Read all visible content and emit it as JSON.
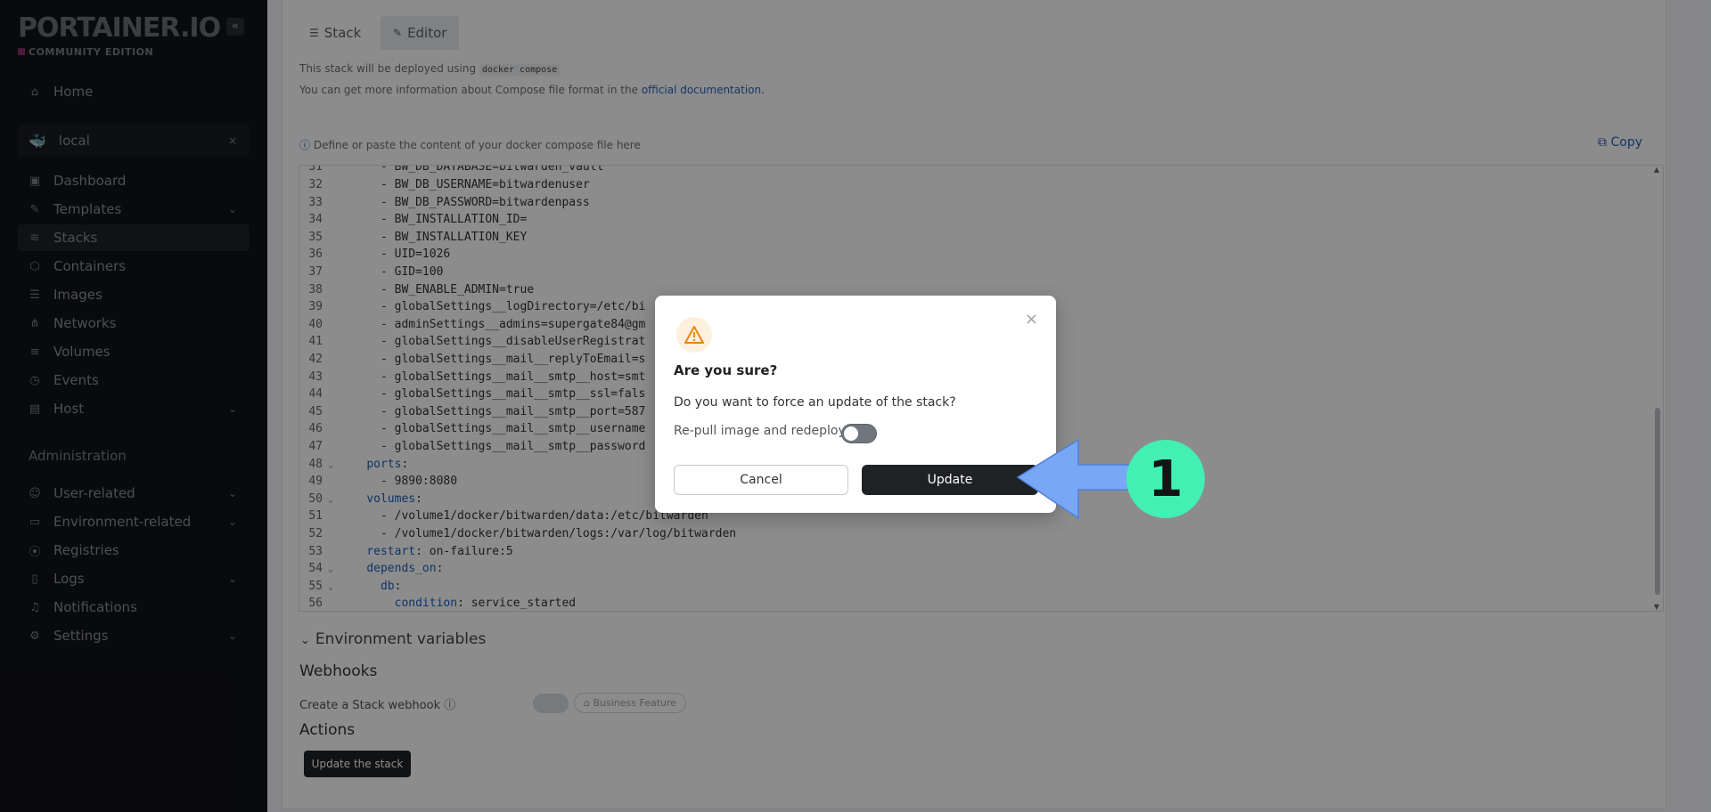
{
  "sidebar": {
    "logo": "PORTAINER.IO",
    "edition": "COMMUNITY EDITION",
    "collapse_icon": "«",
    "home": "Home",
    "environment": {
      "name": "local",
      "close": "×"
    },
    "env_items": [
      {
        "label": "Dashboard",
        "icon": "dashboard-icon"
      },
      {
        "label": "Templates",
        "icon": "templates-icon"
      },
      {
        "label": "Stacks",
        "icon": "stacks-icon"
      },
      {
        "label": "Containers",
        "icon": "containers-icon"
      },
      {
        "label": "Images",
        "icon": "images-icon"
      },
      {
        "label": "Networks",
        "icon": "networks-icon"
      },
      {
        "label": "Volumes",
        "icon": "volumes-icon"
      },
      {
        "label": "Events",
        "icon": "events-icon"
      },
      {
        "label": "Host",
        "icon": "host-icon"
      }
    ],
    "admin_label": "Administration",
    "admin_items": [
      {
        "label": "User-related"
      },
      {
        "label": "Environment-related"
      },
      {
        "label": "Registries"
      },
      {
        "label": "Logs"
      },
      {
        "label": "Notifications"
      },
      {
        "label": "Settings"
      }
    ]
  },
  "main": {
    "tabs": [
      "Stack",
      "Editor"
    ],
    "deploy_text_prefix": "This stack will be deployed using",
    "deploy_cmd": "docker compose",
    "info_text_prefix": "You can get more information about Compose file format in the",
    "info_link": "official documentation.",
    "define_text": "Define or paste the content of your docker compose file here",
    "copy_label": "Copy",
    "code_lines": [
      {
        "n": "32",
        "text": "      - BW_DB_USERNAME=bitwardenuser"
      },
      {
        "n": "33",
        "text": "      - BW_DB_PASSWORD=bitwardenpass"
      },
      {
        "n": "34",
        "text": "      - BW_INSTALLATION_ID="
      },
      {
        "n": "35",
        "text": "      - BW_INSTALLATION_KEY"
      },
      {
        "n": "36",
        "text": "      - UID=1026"
      },
      {
        "n": "37",
        "text": "      - GID=100"
      },
      {
        "n": "38",
        "text": "      - BW_ENABLE_ADMIN=true"
      },
      {
        "n": "39",
        "text": "      - globalSettings__logDirectory=/etc/bi"
      },
      {
        "n": "40",
        "text": "      - adminSettings__admins=supergate84@gm"
      },
      {
        "n": "41",
        "text": "      - globalSettings__disableUserRegistrat"
      },
      {
        "n": "42",
        "text": "      - globalSettings__mail__replyToEmail=s"
      },
      {
        "n": "43",
        "text": "      - globalSettings__mail__smtp__host=smt"
      },
      {
        "n": "44",
        "text": "      - globalSettings__mail__smtp__ssl=fals"
      },
      {
        "n": "45",
        "text": "      - globalSettings__mail__smtp__port=587"
      },
      {
        "n": "46",
        "text": "      - globalSettings__mail__smtp__username"
      },
      {
        "n": "47",
        "text": "      - globalSettings__mail__smtp__password"
      },
      {
        "n": "48",
        "text": "    ports:"
      },
      {
        "n": "49",
        "text": "      - 9890:8080"
      },
      {
        "n": "50",
        "text": "    volumes:"
      },
      {
        "n": "51",
        "text": "      - /volume1/docker/bitwarden/data:/etc/bitwarden"
      },
      {
        "n": "52",
        "text": "      - /volume1/docker/bitwarden/logs:/var/log/bitwarden"
      },
      {
        "n": "53",
        "text": "    restart: on-failure:5"
      },
      {
        "n": "54",
        "text": "    depends_on:"
      },
      {
        "n": "55",
        "text": "      db:"
      },
      {
        "n": "56",
        "text": "        condition: service_started"
      }
    ],
    "env_vars_label": "Environment variables",
    "webhooks_heading": "Webhooks",
    "webhook_label": "Create a Stack webhook",
    "business_feature": "Business Feature",
    "actions_heading": "Actions",
    "update_stack_button": "Update the stack"
  },
  "modal": {
    "title": "Are you sure?",
    "body": "Do you want to force an update of the stack?",
    "repull_label": "Re-pull image and redeploy",
    "repull_enabled": false,
    "cancel_label": "Cancel",
    "update_label": "Update",
    "close": "×"
  },
  "annotation": {
    "step": "1",
    "arrow_color": "#7aa7f5",
    "badge_color": "#43f0b4"
  }
}
